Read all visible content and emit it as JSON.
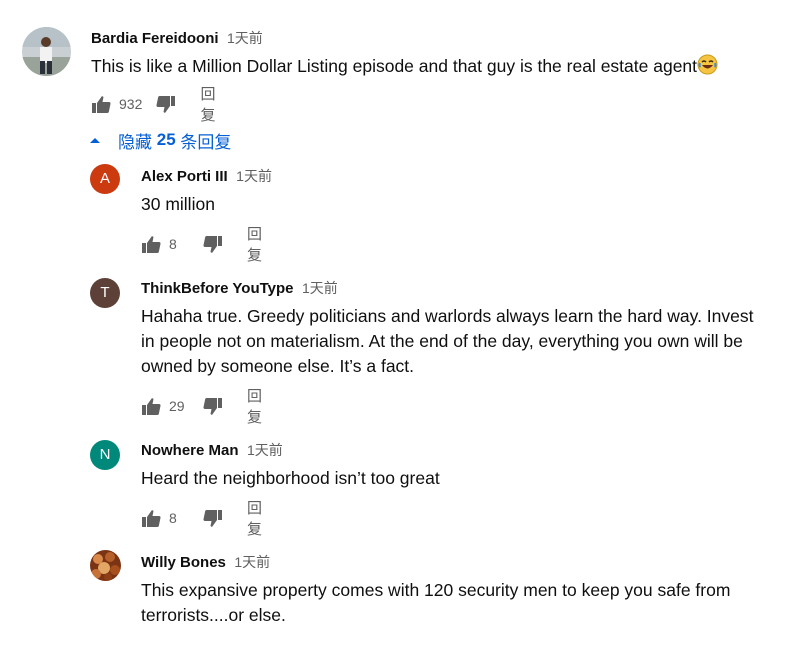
{
  "top_comment": {
    "author": "Bardia Fereidooni",
    "time": "1天前",
    "text": "This is like a Million Dollar Listing episode and that guy is the real estate agent",
    "emoji": "😂",
    "likes": "932",
    "reply_label": "回复"
  },
  "replies_toggle": {
    "prefix": "隐藏 ",
    "count": "25",
    "suffix": " 条回复"
  },
  "replies": [
    {
      "author": "Alex Porti III",
      "time": "1天前",
      "initial": "A",
      "avatar_color": "#cc3a10",
      "lines": [
        "30 million"
      ],
      "likes": "8",
      "reply_label": "回复"
    },
    {
      "author": "ThinkBefore YouType",
      "time": "1天前",
      "initial": "T",
      "avatar_color": "#5d4037",
      "lines": [
        "Hahaha true. Greedy politicians and warlords always learn the hard way. Invest",
        "in people not on materialism. At the end of the day, everything you own will be",
        "owned by someone else. It’s a fact."
      ],
      "likes": "29",
      "reply_label": "回复"
    },
    {
      "author": "Nowhere Man",
      "time": "1天前",
      "initial": "N",
      "avatar_color": "#00897b",
      "lines": [
        "Heard the neighborhood isn’t too great"
      ],
      "likes": "8",
      "reply_label": "回复"
    },
    {
      "author": "Willy Bones",
      "time": "1天前",
      "initial": "",
      "avatar_color": "#8a3f1a",
      "lines": [
        "This expansive property comes with 120 security men to keep you safe from",
        "terrorists....or else."
      ],
      "likes": "",
      "reply_label": ""
    }
  ],
  "colors": {
    "link_blue": "#065fd4",
    "meta_gray": "#606060",
    "text_dark": "#0f0f0f"
  },
  "icons": {
    "like": "thumb-up-icon",
    "dislike": "thumb-down-icon",
    "toggle": "caret-up-icon"
  }
}
